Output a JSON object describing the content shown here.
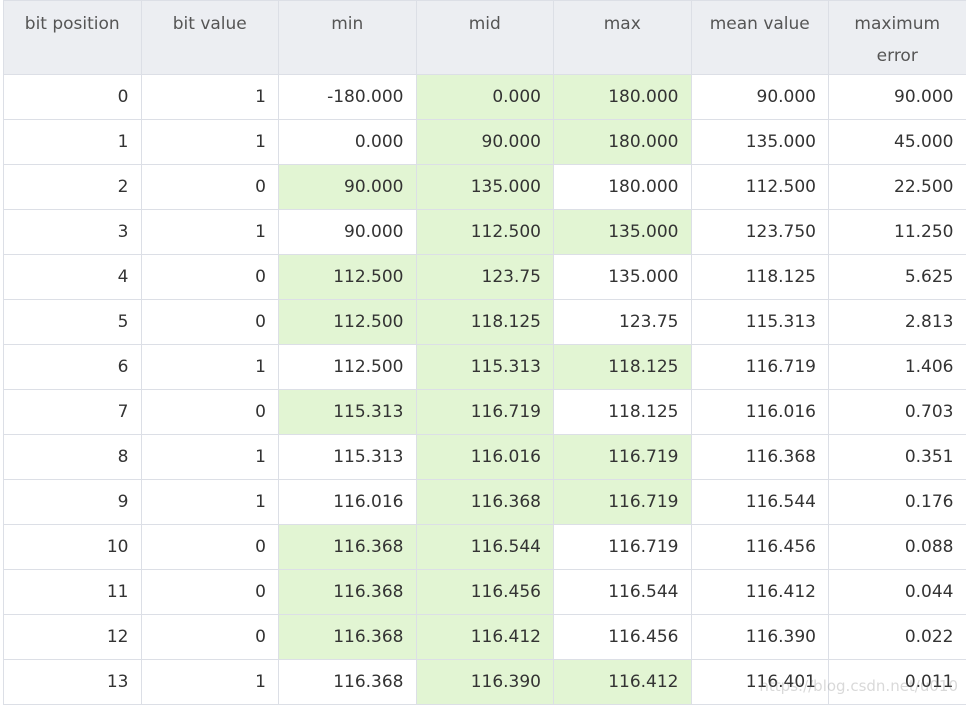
{
  "headers": [
    "bit position",
    "bit value",
    "min",
    "mid",
    "max",
    "mean value",
    "maximum error"
  ],
  "rows": [
    {
      "cells": [
        "0",
        "1",
        "-180.000",
        "0.000",
        "180.000",
        "90.000",
        "90.000"
      ],
      "hl": [
        3,
        4
      ]
    },
    {
      "cells": [
        "1",
        "1",
        "0.000",
        "90.000",
        "180.000",
        "135.000",
        "45.000"
      ],
      "hl": [
        3,
        4
      ]
    },
    {
      "cells": [
        "2",
        "0",
        "90.000",
        "135.000",
        "180.000",
        "112.500",
        "22.500"
      ],
      "hl": [
        2,
        3
      ]
    },
    {
      "cells": [
        "3",
        "1",
        "90.000",
        "112.500",
        "135.000",
        "123.750",
        "11.250"
      ],
      "hl": [
        3,
        4
      ]
    },
    {
      "cells": [
        "4",
        "0",
        "112.500",
        "123.75",
        "135.000",
        "118.125",
        "5.625"
      ],
      "hl": [
        2,
        3
      ]
    },
    {
      "cells": [
        "5",
        "0",
        "112.500",
        "118.125",
        "123.75",
        "115.313",
        "2.813"
      ],
      "hl": [
        2,
        3
      ]
    },
    {
      "cells": [
        "6",
        "1",
        "112.500",
        "115.313",
        "118.125",
        "116.719",
        "1.406"
      ],
      "hl": [
        3,
        4
      ]
    },
    {
      "cells": [
        "7",
        "0",
        "115.313",
        "116.719",
        "118.125",
        "116.016",
        "0.703"
      ],
      "hl": [
        2,
        3
      ]
    },
    {
      "cells": [
        "8",
        "1",
        "115.313",
        "116.016",
        "116.719",
        "116.368",
        "0.351"
      ],
      "hl": [
        3,
        4
      ]
    },
    {
      "cells": [
        "9",
        "1",
        "116.016",
        "116.368",
        "116.719",
        "116.544",
        "0.176"
      ],
      "hl": [
        3,
        4
      ]
    },
    {
      "cells": [
        "10",
        "0",
        "116.368",
        "116.544",
        "116.719",
        "116.456",
        "0.088"
      ],
      "hl": [
        2,
        3
      ]
    },
    {
      "cells": [
        "11",
        "0",
        "116.368",
        "116.456",
        "116.544",
        "116.412",
        "0.044"
      ],
      "hl": [
        2,
        3
      ]
    },
    {
      "cells": [
        "12",
        "0",
        "116.368",
        "116.412",
        "116.456",
        "116.390",
        "0.022"
      ],
      "hl": [
        2,
        3
      ]
    },
    {
      "cells": [
        "13",
        "1",
        "116.368",
        "116.390",
        "116.412",
        "116.401",
        "0.011"
      ],
      "hl": [
        3,
        4
      ]
    }
  ],
  "watermark": "https://blog.csdn.net/u010",
  "colors": {
    "highlight": "#e2f5d3",
    "header_bg": "#eceef2",
    "border": "#dcdfe6"
  }
}
